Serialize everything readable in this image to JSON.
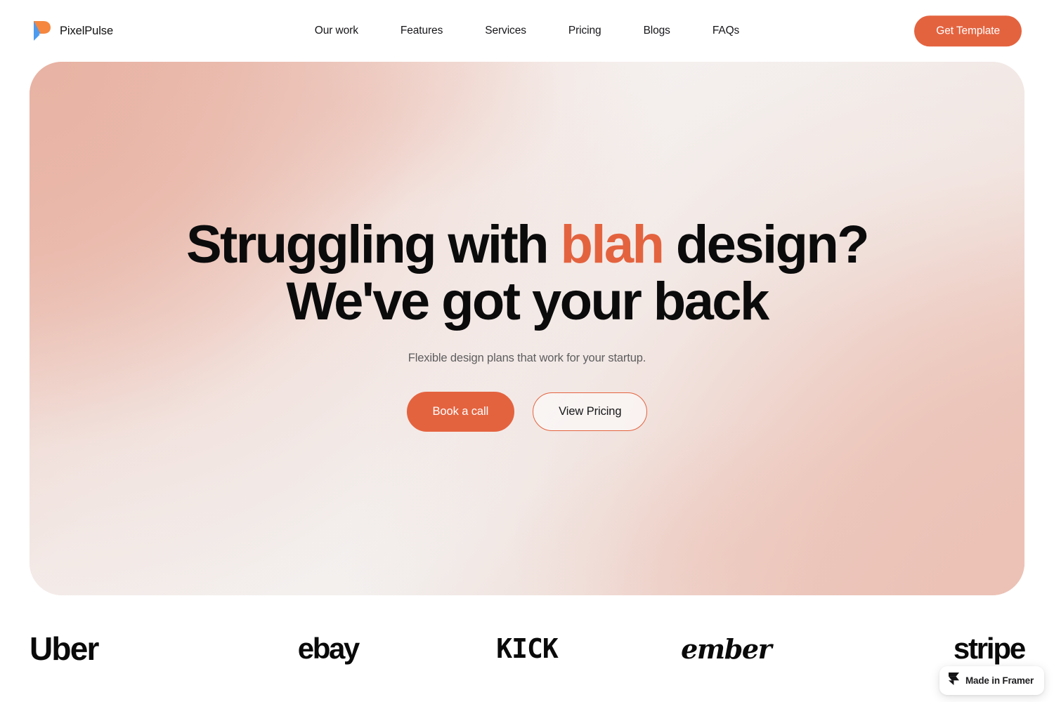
{
  "brand": {
    "name": "PixelPulse",
    "logo_icon": "pixelpulse-logo-icon",
    "logo_colors": {
      "top": "#F5873F",
      "bottom": "#4B9BF0"
    }
  },
  "nav": {
    "items": [
      {
        "label": "Our work"
      },
      {
        "label": "Features"
      },
      {
        "label": "Services"
      },
      {
        "label": "Pricing"
      },
      {
        "label": "Blogs"
      },
      {
        "label": "FAQs"
      }
    ],
    "cta_label": "Get Template"
  },
  "hero": {
    "title_part1": "Struggling with ",
    "title_accent": "blah",
    "title_part2": " design?",
    "title_line2": "We've got your back",
    "subtitle": "Flexible design plans that work for your startup.",
    "primary_cta": "Book a call",
    "secondary_cta": "View Pricing"
  },
  "logos": [
    {
      "name": "Uber",
      "label": "Uber"
    },
    {
      "name": "ebay",
      "label": "ebay"
    },
    {
      "name": "KICK",
      "label": "KICK"
    },
    {
      "name": "ember",
      "label": "ember"
    },
    {
      "name": "stripe",
      "label": "stripe"
    }
  ],
  "framer_badge": {
    "label": "Made in Framer",
    "icon": "framer-logo-icon"
  },
  "colors": {
    "accent": "#E4633F",
    "text": "#0B0B0C",
    "muted_text": "#5D5D5F",
    "hero_pink": "#EABAAC",
    "hero_white": "#F3F2F1"
  }
}
